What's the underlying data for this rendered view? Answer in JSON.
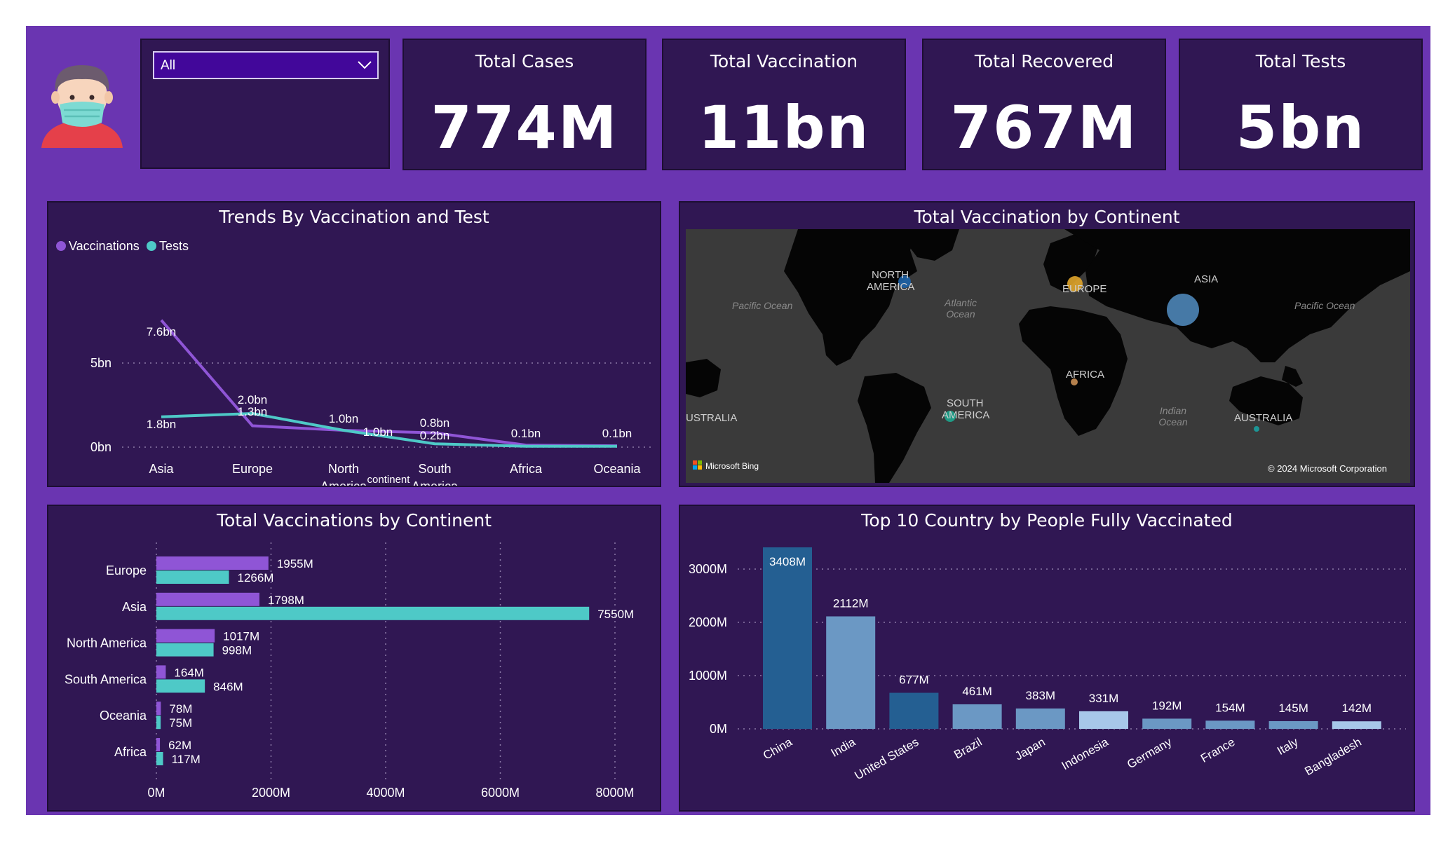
{
  "avatar": {
    "icon": "masked-person-icon"
  },
  "slicer": {
    "value": "All"
  },
  "kpis": [
    {
      "title": "Total Cases",
      "value": "774M"
    },
    {
      "title": "Total Vaccination",
      "value": "11bn"
    },
    {
      "title": "Total Recovered",
      "value": "767M"
    },
    {
      "title": "Total Tests",
      "value": "5bn"
    }
  ],
  "line_panel": {
    "title": "Trends By Vaccination and Test"
  },
  "map_panel": {
    "title": "Total Vaccination by Continent",
    "labels": {
      "north_america": [
        "NORTH",
        "AMERICA"
      ],
      "europe": "EUROPE",
      "asia": "ASIA",
      "africa": "AFRICA",
      "south_america": [
        "SOUTH",
        "AMERICA"
      ],
      "australia_left": "USTRALIA",
      "australia": "AUSTRALIA",
      "pacific_left": "Pacific Ocean",
      "pacific_right": "Pacific Ocean",
      "atlantic": [
        "Atlantic",
        "Ocean"
      ],
      "indian": [
        "Indian",
        "Ocean"
      ]
    },
    "brand": "Microsoft Bing",
    "copyright": "© 2024 Microsoft Corporation"
  },
  "hbar_panel": {
    "title": "Total Vaccinations by Continent"
  },
  "col_panel": {
    "title": "Top 10 Country by People Fully Vaccinated"
  },
  "colors": {
    "vaccinations": "#8f55d6",
    "tests": "#4ec9c7",
    "dark_blue": "#245f92",
    "light_blue": "#6b98c4",
    "pale_blue": "#a7c7e9"
  },
  "chart_data": [
    {
      "type": "line",
      "title": "Trends By Vaccination and Test",
      "xlabel": "continent",
      "ylabel": "",
      "legend": "top-left",
      "categories": [
        "Asia",
        "Europe",
        "North America",
        "South America",
        "Africa",
        "Oceania"
      ],
      "category_lines": [
        [
          "Asia"
        ],
        [
          "Europe"
        ],
        [
          "North",
          "America"
        ],
        [
          "South",
          "America"
        ],
        [
          "Africa"
        ],
        [
          "Oceania"
        ]
      ],
      "yticks": [
        {
          "value": 0,
          "label": "0bn"
        },
        {
          "value": 5,
          "label": "5bn"
        }
      ],
      "ylim": [
        0,
        8
      ],
      "series": [
        {
          "name": "Vaccinations",
          "values": [
            7.55,
            1.27,
            1.0,
            0.85,
            0.12,
            0.08
          ],
          "labels": [
            "7.6bn",
            "1.3bn",
            "1.0bn",
            "0.8bn",
            "0.1bn",
            "0.1bn"
          ]
        },
        {
          "name": "Tests",
          "values": [
            1.8,
            2.0,
            1.0,
            0.2,
            0.05,
            0.05
          ],
          "labels": [
            "1.8bn",
            "2.0bn",
            "1.0bn",
            "0.2bn",
            "",
            ""
          ]
        }
      ]
    },
    {
      "type": "bubble-map",
      "title": "Total Vaccination by Continent",
      "points": [
        {
          "name": "North America",
          "relative_size": 0.5
        },
        {
          "name": "Europe",
          "relative_size": 0.6
        },
        {
          "name": "Asia",
          "relative_size": 1.0
        },
        {
          "name": "Africa",
          "relative_size": 0.25
        },
        {
          "name": "South America",
          "relative_size": 0.45
        },
        {
          "name": "Oceania",
          "relative_size": 0.2
        }
      ]
    },
    {
      "type": "bar",
      "orientation": "horizontal",
      "title": "Total Vaccinations by Continent",
      "categories": [
        "Europe",
        "Asia",
        "North America",
        "South America",
        "Oceania",
        "Africa"
      ],
      "xlim": [
        0,
        8000
      ],
      "xticks": [
        0,
        2000,
        4000,
        6000,
        8000
      ],
      "xtick_labels": [
        "0M",
        "2000M",
        "4000M",
        "6000M",
        "8000M"
      ],
      "series": [
        {
          "values": [
            1955,
            1798,
            1017,
            164,
            78,
            62
          ],
          "labels": [
            "1955M",
            "1798M",
            "1017M",
            "164M",
            "78M",
            "62M"
          ]
        },
        {
          "values": [
            1266,
            7550,
            998,
            846,
            75,
            117
          ],
          "labels": [
            "1266M",
            "7550M",
            "998M",
            "846M",
            "75M",
            "117M"
          ]
        }
      ]
    },
    {
      "type": "bar",
      "title": "Top 10 Country by People Fully Vaccinated",
      "categories": [
        "China",
        "India",
        "United States",
        "Brazil",
        "Japan",
        "Indonesia",
        "Germany",
        "France",
        "Italy",
        "Bangladesh"
      ],
      "values": [
        3408,
        2112,
        677,
        461,
        383,
        331,
        192,
        154,
        145,
        142
      ],
      "labels": [
        "3408M",
        "2112M",
        "677M",
        "461M",
        "383M",
        "331M",
        "192M",
        "154M",
        "145M",
        "142M"
      ],
      "bar_colors": [
        "#245f92",
        "#6b98c4",
        "#245f92",
        "#6b98c4",
        "#6b98c4",
        "#a7c7e9",
        "#6b98c4",
        "#6b98c4",
        "#6b98c4",
        "#a7c7e9"
      ],
      "ylim": [
        0,
        3600
      ],
      "yticks": [
        0,
        1000,
        2000,
        3000
      ],
      "ytick_labels": [
        "0M",
        "1000M",
        "2000M",
        "3000M"
      ]
    }
  ]
}
